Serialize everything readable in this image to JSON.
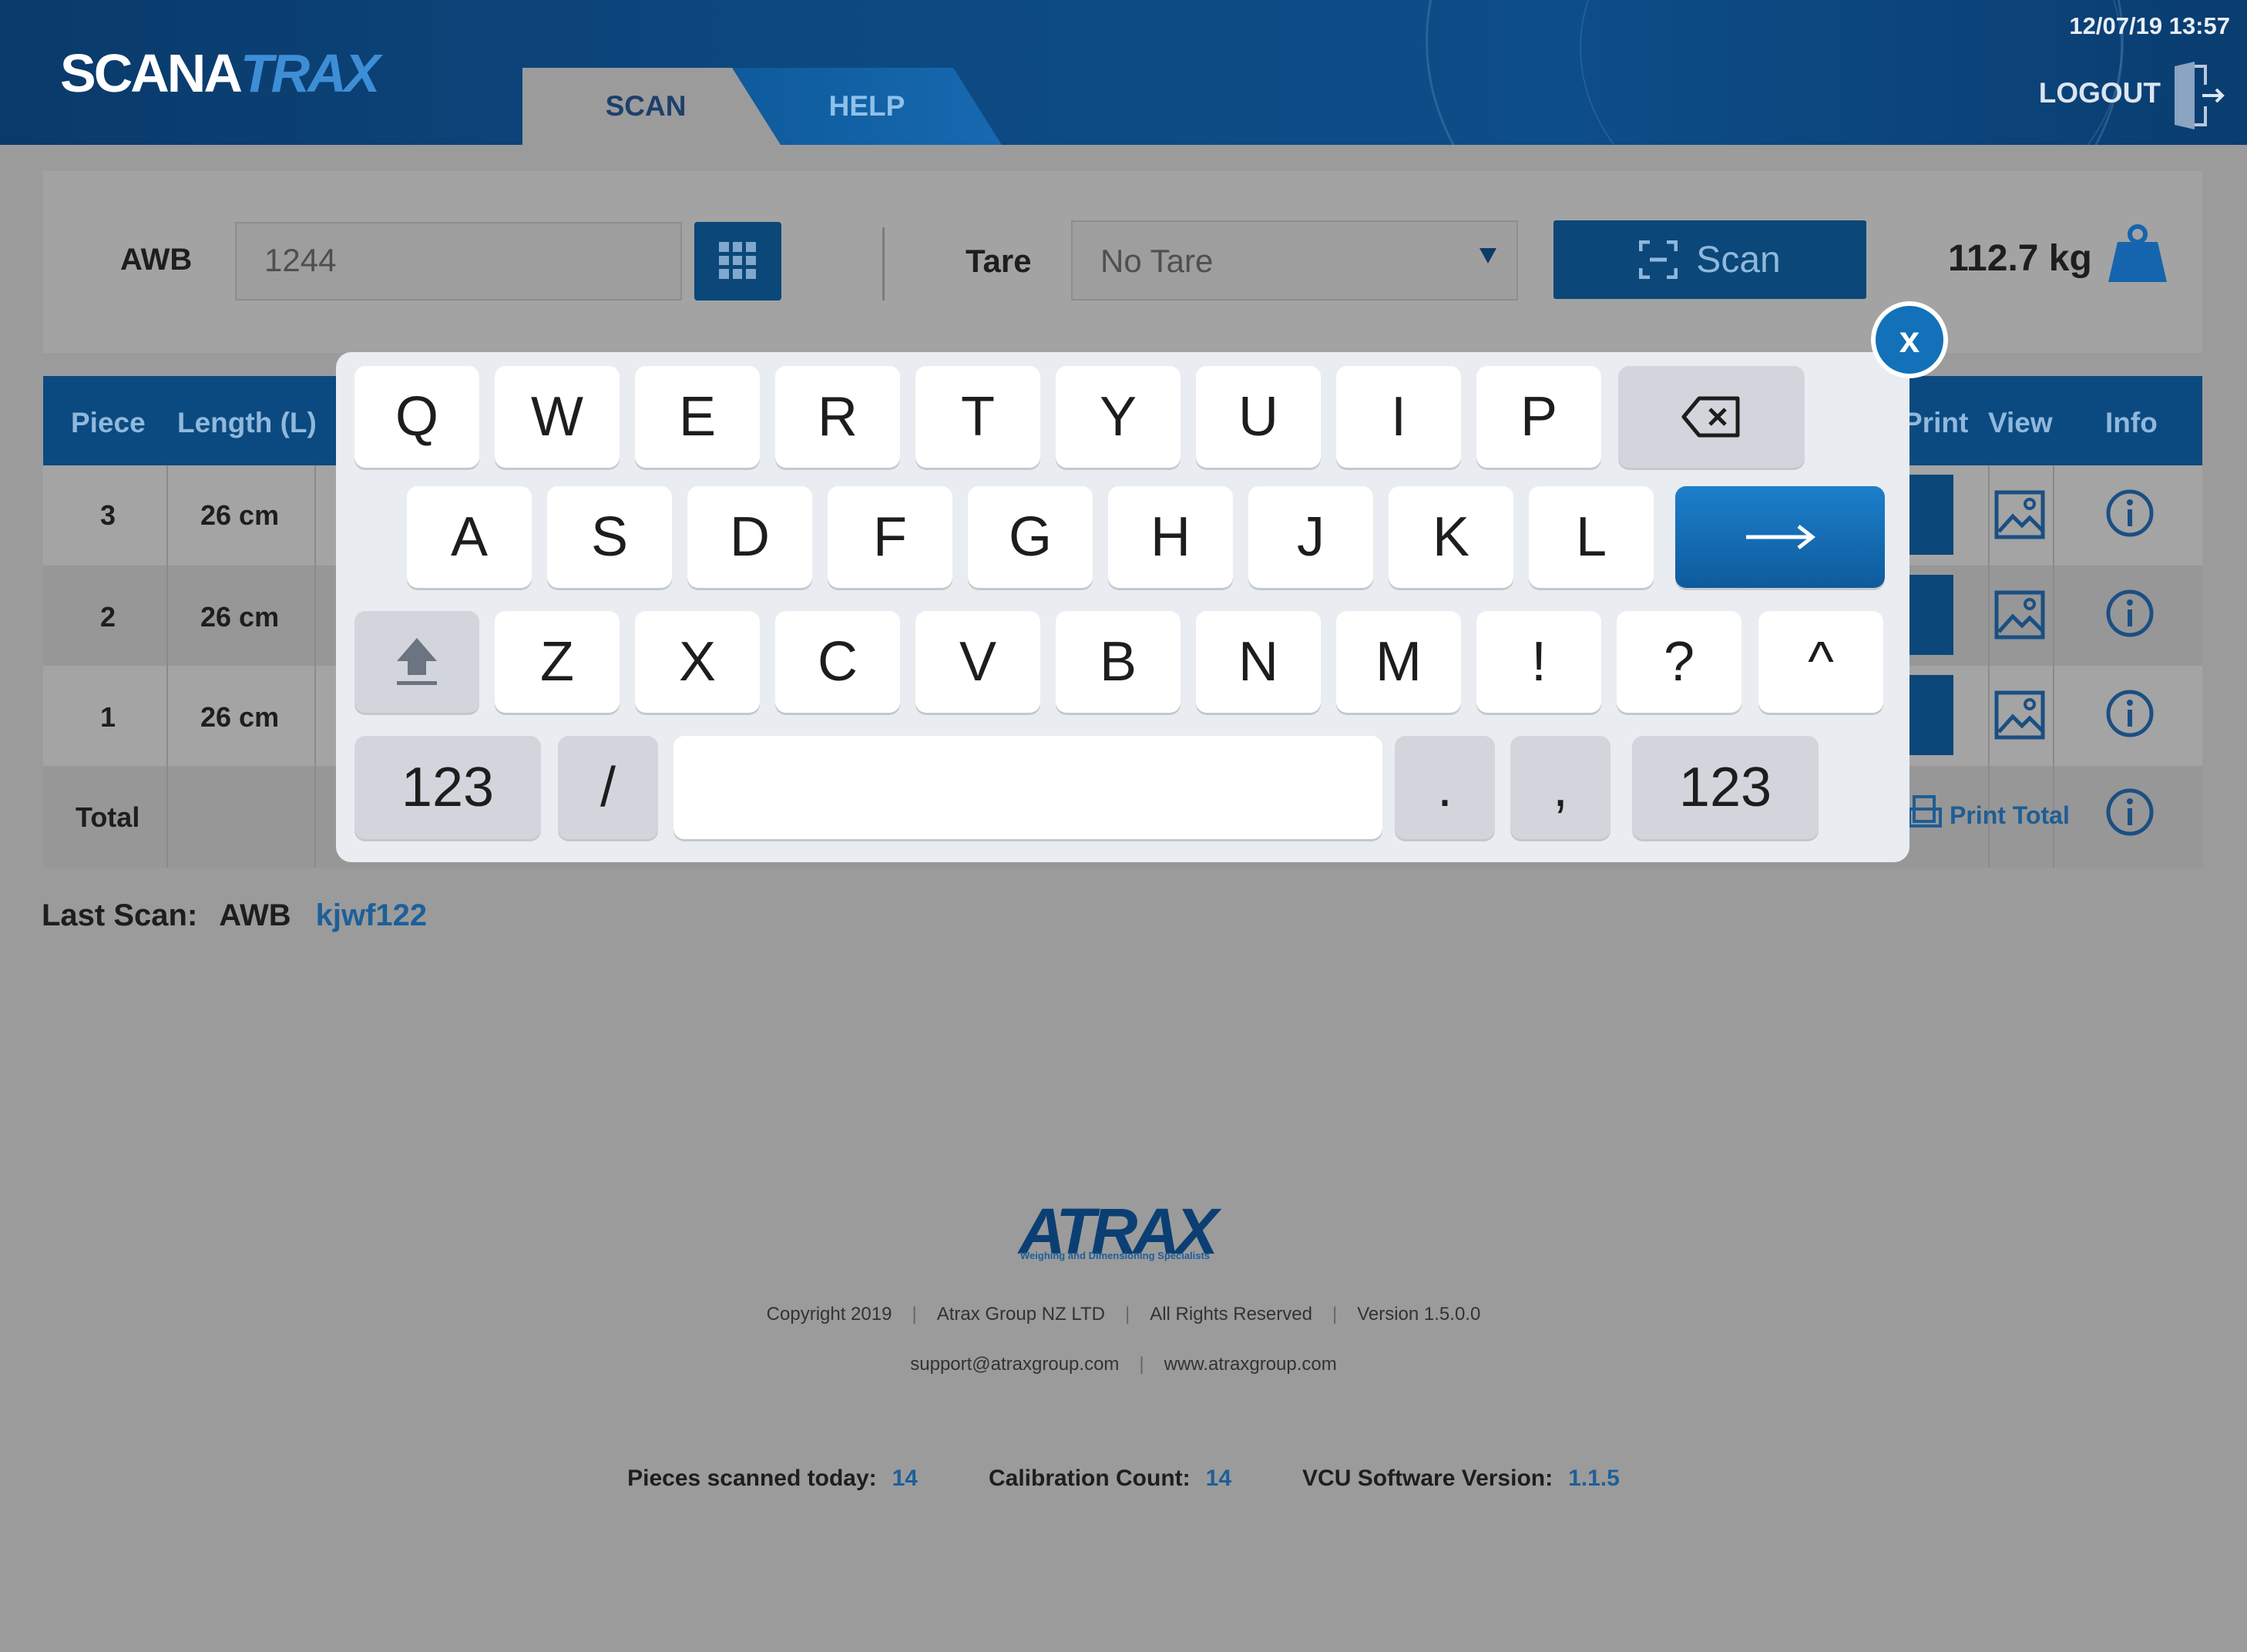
{
  "header": {
    "logo_part1": "SCANA",
    "logo_part2": "TRAX",
    "tabs": [
      {
        "label": "SCAN"
      },
      {
        "label": "HELP"
      }
    ],
    "datetime": "12/07/19 13:57",
    "logout_label": "LOGOUT"
  },
  "awb_bar": {
    "awb_label": "AWB",
    "awb_value": "1244",
    "tare_label": "Tare",
    "tare_value": "No Tare",
    "scan_label": "Scan",
    "weight": "112.7 kg"
  },
  "table": {
    "columns": {
      "piece": "Piece",
      "length": "Length (L)",
      "print": "Print",
      "view": "View",
      "info": "Info"
    },
    "rows": [
      {
        "piece": "3",
        "length": "26 cm"
      },
      {
        "piece": "2",
        "length": "26 cm"
      },
      {
        "piece": "1",
        "length": "26 cm"
      }
    ],
    "total_label": "Total",
    "print_total_label": "Print Total"
  },
  "last_scan": {
    "label": "Last Scan:",
    "type": "AWB",
    "value": "kjwf122"
  },
  "footer": {
    "brand": "ATRAX",
    "tagline": "Weighing and Dimensioning Specialists",
    "copyright": "Copyright 2019",
    "company": "Atrax Group NZ LTD",
    "rights": "All Rights Reserved",
    "version": "Version 1.5.0.0",
    "email": "support@atraxgroup.com",
    "website": "www.atraxgroup.com",
    "stats": {
      "pieces_label": "Pieces scanned today:",
      "pieces_value": "14",
      "calibration_label": "Calibration Count:",
      "calibration_value": "14",
      "vcu_label": "VCU Software Version:",
      "vcu_value": "1.1.5"
    }
  },
  "keyboard": {
    "row1": [
      "Q",
      "W",
      "E",
      "R",
      "T",
      "Y",
      "U",
      "I",
      "P"
    ],
    "row2": [
      "A",
      "S",
      "D",
      "F",
      "G",
      "H",
      "J",
      "K",
      "L"
    ],
    "row3": [
      "Z",
      "X",
      "C",
      "V",
      "B",
      "N",
      "M",
      "!",
      "?",
      "^"
    ],
    "numbers_label": "123",
    "slash": "/",
    "period": ".",
    "comma": ",",
    "close_label": "x",
    "enter_icon": "arrow-right-icon",
    "backspace_icon": "backspace-icon",
    "shift_icon": "shift-up-icon"
  },
  "colors": {
    "header_blue": "#0d4a82",
    "button_blue": "#0b4779",
    "accent_blue": "#1e5f99",
    "overlay_grey": "#9b9b9b"
  }
}
